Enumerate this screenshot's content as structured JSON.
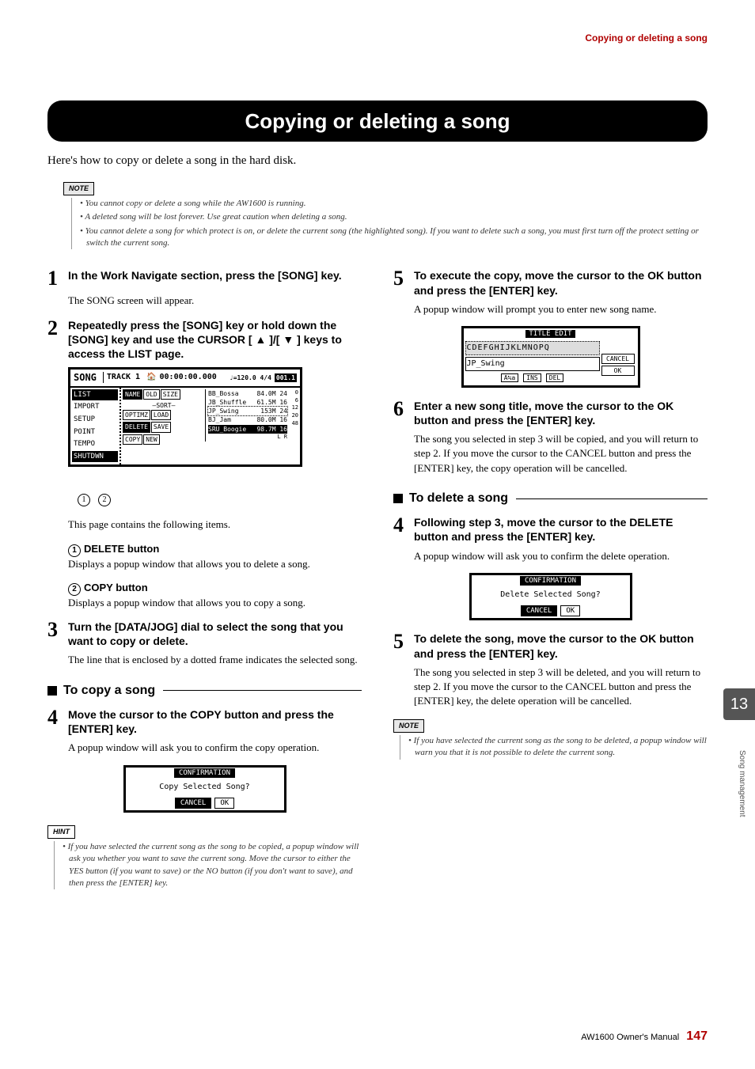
{
  "header": {
    "section": "Copying or deleting a song"
  },
  "title": "Copying or deleting a song",
  "intro": "Here's how to copy or delete a song in the hard disk.",
  "notes_label": "NOTE",
  "hint_label": "HINT",
  "top_notes": [
    "You cannot copy or delete a song while the AW1600 is running.",
    "A deleted song will be lost forever. Use great caution when deleting a song.",
    "You cannot delete a song for which protect is on, or delete the current song (the highlighted song). If you want to delete such a song, you must first turn off the protect setting or switch the current song."
  ],
  "left": {
    "step1": {
      "n": "1",
      "head": "In the Work Navigate section, press the [SONG] key.",
      "body": "The SONG screen will appear."
    },
    "step2": {
      "n": "2",
      "head": "Repeatedly press the [SONG] key or hold down the [SONG] key and use the CURSOR [ ▲ ]/[ ▼ ] keys to access the LIST page."
    },
    "screen": {
      "title": "SONG",
      "track": "TRACK  1",
      "counter": "00:00:00.000",
      "tempo": "♩=120.0 4/4",
      "bar": "001.1",
      "side": [
        "LIST",
        "IMPORT",
        "SETUP",
        "POINT",
        "TEMPO",
        "SHUTDWN"
      ],
      "tabs1": [
        "NAME",
        "OLD",
        "SIZE"
      ],
      "sort": "SORT",
      "tabs2": [
        "OPTIMZ",
        "LOAD"
      ],
      "tabs3": [
        "DELETE",
        "SAVE"
      ],
      "tabs4": [
        "COPY",
        "NEW"
      ],
      "rows": [
        {
          "name": "BB_Bossa",
          "size": "84.0M 24",
          "lr": "0"
        },
        {
          "name": "JB_Shuffle",
          "size": "61.5M 16",
          "lr": "6"
        },
        {
          "name": "JP_Swing",
          "size": "153M 24",
          "lr": "12"
        },
        {
          "name": "BJ_Jam",
          "size": "80.0M 16",
          "lr": "20"
        },
        {
          "name": "SRU_Boogie",
          "size": "98.7M 16",
          "lr": "48"
        }
      ],
      "meter": "L R"
    },
    "call_1": "1",
    "call_2": "2",
    "items_intro": "This page contains the following items.",
    "item1": {
      "num": "1",
      "title": "DELETE button",
      "body": "Displays a popup window that allows you to delete a song."
    },
    "item2": {
      "num": "2",
      "title": "COPY button",
      "body": "Displays a popup window that allows you to copy a song."
    },
    "step3": {
      "n": "3",
      "head": "Turn the [DATA/JOG] dial to select the song that you want to copy or delete.",
      "body": "The line that is enclosed by a dotted frame indicates the selected song."
    },
    "sec_copy": "To copy a song",
    "step4c": {
      "n": "4",
      "head": "Move the cursor to the COPY button and press the [ENTER] key.",
      "body": "A popup window will ask you to confirm the copy operation."
    },
    "popup_copy": {
      "title": "CONFIRMATION",
      "msg": "Copy Selected Song?",
      "cancel": "CANCEL",
      "ok": "OK"
    },
    "hint": "If you have selected the current song as the song to be copied, a popup window will ask you whether you want to save the current song. Move the cursor to either the YES button (if you want to save) or the NO button (if you don't want to save), and then press the [ENTER] key."
  },
  "right": {
    "step5c": {
      "n": "5",
      "head": "To execute the copy, move the cursor to the OK button and press the [ENTER] key.",
      "body": "A popup window will prompt you to enter new song name."
    },
    "title_edit": {
      "title": "TITLE EDIT",
      "chars": "CDEFGHIJKLMNOPQ",
      "input": "JP_Swing",
      "btns": [
        "A≒a",
        "INS",
        "DEL"
      ],
      "cancel": "CANCEL",
      "ok": "OK"
    },
    "step6": {
      "n": "6",
      "head": "Enter a new song title, move the cursor to the OK button and press the [ENTER] key.",
      "body": "The song you selected in step 3 will be copied, and you will return to step 2. If you move the cursor to the CANCEL button and press the [ENTER] key, the copy operation will be cancelled."
    },
    "sec_delete": "To delete a song",
    "step4d": {
      "n": "4",
      "head": "Following step 3, move the cursor to the DELETE button and press the [ENTER] key.",
      "body": "A popup window will ask you to confirm the delete operation."
    },
    "popup_del": {
      "title": "CONFIRMATION",
      "msg": "Delete Selected Song?",
      "cancel": "CANCEL",
      "ok": "OK"
    },
    "step5d": {
      "n": "5",
      "head": "To delete the song, move the cursor to the OK button and press the [ENTER] key.",
      "body": "The song you selected in step 3 will be deleted, and you will return to step 2. If you move the cursor to the CANCEL button and press the [ENTER] key, the delete operation will be cancelled."
    },
    "note2": "If you have selected the current song as the song to be deleted, a popup window will warn you that it is not possible to delete the current song."
  },
  "thumb": "13",
  "side_label": "Song management",
  "footer": {
    "model": "AW1600  Owner's Manual",
    "page": "147"
  }
}
